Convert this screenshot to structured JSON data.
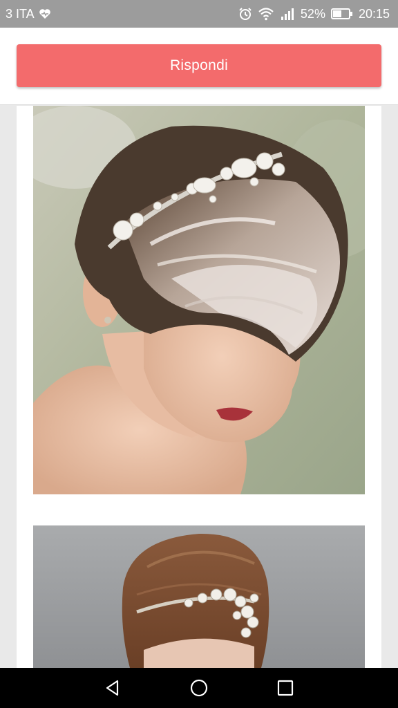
{
  "status_bar": {
    "carrier": "3 ITA",
    "battery_percent": "52%",
    "time": "20:15",
    "icons": [
      "heart-icon",
      "alarm-icon",
      "wifi-icon",
      "signal-icon",
      "battery-icon"
    ]
  },
  "reply": {
    "label": "Rispondi",
    "color": "#f36b6c"
  },
  "content": {
    "images": [
      {
        "subject": "short-pixie-hair-with-jeweled-headband-photo"
      },
      {
        "subject": "brown-short-hair-with-jeweled-headband-photo"
      }
    ]
  },
  "nav": {
    "buttons": [
      "back-icon",
      "home-icon",
      "recents-icon"
    ]
  }
}
